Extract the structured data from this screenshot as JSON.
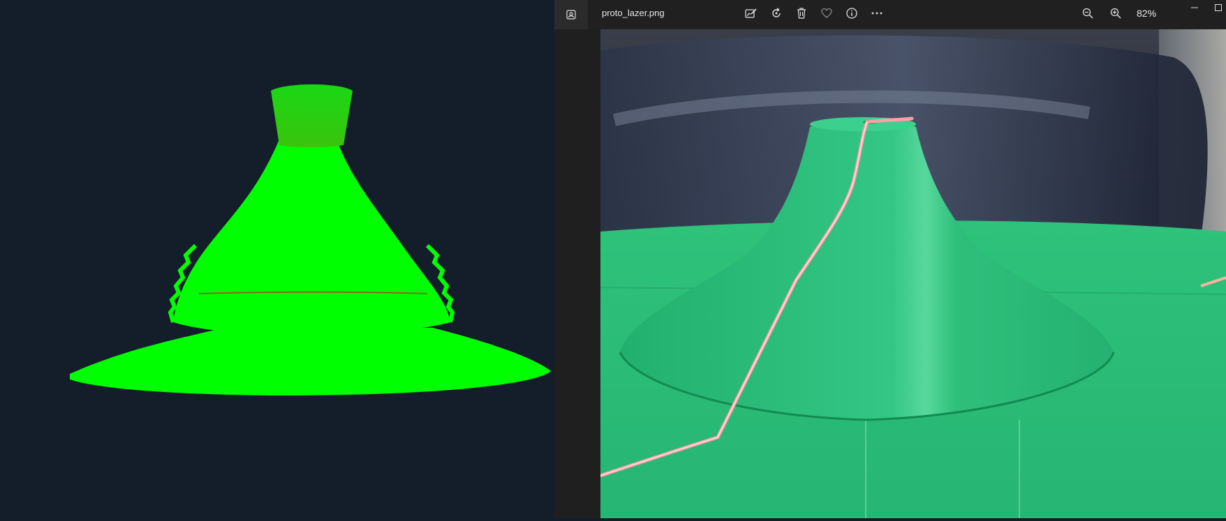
{
  "viewer3d": {
    "background": "#131e2a",
    "model_color": "#00ff00",
    "stripe_color": "#b0462a"
  },
  "titlebar": {
    "filename": "proto_lazer.png",
    "zoom_level": "82%",
    "tools": [
      "edit-icon",
      "rotate-icon",
      "delete-icon",
      "favorite-icon",
      "info-icon",
      "more-icon"
    ],
    "zoom_tools": [
      "zoom-out-icon",
      "zoom-in-icon"
    ]
  },
  "photo": {
    "object_color": "#2fbf7a",
    "laser_color": "#ff9ea8"
  }
}
